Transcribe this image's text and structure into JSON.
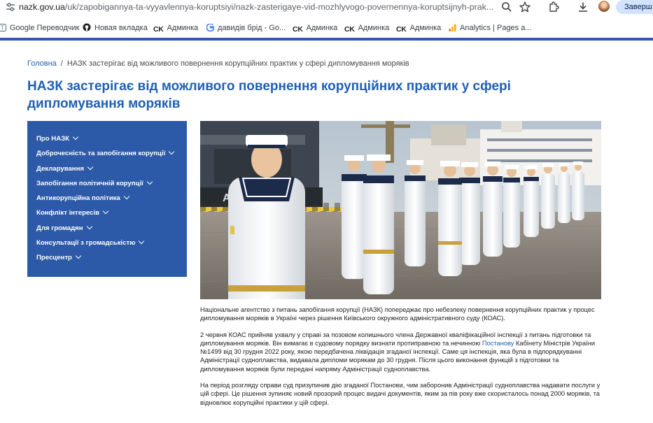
{
  "browser": {
    "url_host": "nazk.gov.ua",
    "url_path": "/uk/zapobigannya-ta-vyyavlennya-koruptsiyi/nazk-zasterigaye-vid-mozhlyvogo-povernennya-koruptsijnyh-prak...",
    "update_label": "Заверш"
  },
  "bookmarks": [
    {
      "label": "Google Переводчик",
      "icon": "translate-icon"
    },
    {
      "label": "Новая вкладка",
      "icon": "github-icon"
    },
    {
      "label": "Админка",
      "icon": "ck-icon"
    },
    {
      "label": "давидів брід - Go...",
      "icon": "google-icon"
    },
    {
      "label": "Админка",
      "icon": "ck-icon"
    },
    {
      "label": "Админка",
      "icon": "ck-icon"
    },
    {
      "label": "Админка",
      "icon": "ck-icon"
    },
    {
      "label": "Analytics | Pages a...",
      "icon": "analytics-icon"
    }
  ],
  "bookmark_ck_text": "CK",
  "breadcrumb": {
    "home": "Головна",
    "separator": "/",
    "current": "НАЗК застерігає від можливого повернення корупційних практик у сфері дипломування моряків"
  },
  "page_title": "НАЗК застерігає від можливого повернення корупційних практик у сфері дипломування моряків",
  "sidebar": {
    "items": [
      "Про НАЗК",
      "Доброчесність та запобігання корупції",
      "Декларування",
      "Запобігання політичній корупції",
      "Антикорупційна політика",
      "Конфлікт інтересів",
      "Для громадян",
      "Консультації з громадськістю",
      "Пресцентр"
    ]
  },
  "article": {
    "p1": "Національне агентство з питань запобігання корупції (НАЗК) попереджає про небезпеку повернення корупційних практик у процес дипломування моряків в Україні через рішення Київського окружного адміністративного суду (КОАС).",
    "p2_before": "2 червня КОАС прийняв ухвалу у справі за позовом колишнього члена Державної кваліфікаційної інспекції з питань підготовки та дипломування моряків. Він вимагає в судовому порядку визнати протиправною та нечинною ",
    "p2_link": "Постанову",
    "p2_after": " Кабінету Міністрів України №1499 від 30 грудня 2022 року, якою передбачена ліквідація згаданої інспекції. Саме ця інспекція, яка була в підпорядкуванні  Адміністрації судноплавства, видавала дипломи морякам до 30 грудня. Після цього виконання функцій з підготовки та дипломування моряків були передані напряму Адміністрації судноплавства.",
    "p3": "На період розгляду справи суд призупинив дію згаданої Постанови, чим заборонив Адміністрації судноплавства надавати послуги у цій сфері. Це рішення зупиняє новий прозорий процес видачі документів, яким за пів року вже скористалось понад  2000 моряків, та відновлює корупційні практики у цій сфері."
  },
  "colors": {
    "brand_blue": "#2c5aa8",
    "title_blue": "#1f5fb3",
    "link_blue": "#1f5fb3"
  }
}
